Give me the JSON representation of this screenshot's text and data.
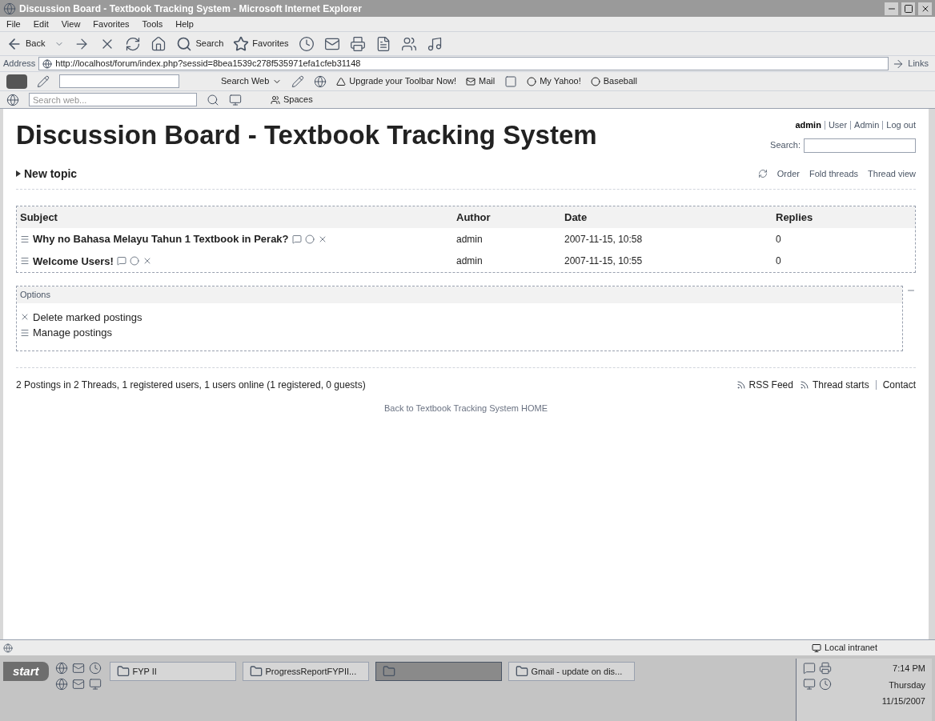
{
  "window": {
    "title": "Discussion Board - Textbook Tracking System - Microsoft Internet Explorer"
  },
  "menu": [
    "File",
    "Edit",
    "View",
    "Favorites",
    "Tools",
    "Help"
  ],
  "toolbar": {
    "back": "Back",
    "search": "Search",
    "favorites": "Favorites"
  },
  "address": {
    "label": "Address",
    "value": "http://localhost/forum/index.php?sessid=8bea1539c278f535971efa1cfeb31148",
    "links": "Links"
  },
  "yahoo_toolbar": {
    "search_web": "Search Web",
    "upgrade": "Upgrade your Toolbar Now!",
    "mail": "Mail",
    "my_yahoo": "My Yahoo!",
    "baseball": "Baseball"
  },
  "search_toolbar": {
    "placeholder": "Search web...",
    "spaces": "Spaces"
  },
  "page": {
    "title": "Discussion Board - Textbook Tracking System",
    "user_links": [
      {
        "label": "admin",
        "kind": "user"
      },
      {
        "label": "User",
        "kind": "link"
      },
      {
        "label": "Admin",
        "kind": "link"
      },
      {
        "label": "Log out",
        "kind": "link"
      }
    ],
    "search_label": "Search:",
    "new_topic": "New topic",
    "view_links": [
      "Order",
      "Fold threads",
      "Thread view"
    ],
    "table": {
      "columns": [
        "Subject",
        "Author",
        "Date",
        "Replies"
      ],
      "rows": [
        {
          "subject": "Why no Bahasa Melayu Tahun 1 Textbook in Perak?",
          "author": "admin",
          "date": "2007-11-15, 10:58",
          "replies": "0"
        },
        {
          "subject": "Welcome Users!",
          "author": "admin",
          "date": "2007-11-15, 10:55",
          "replies": "0"
        }
      ]
    },
    "options": {
      "title": "Options",
      "items": [
        "Delete marked postings",
        "Manage postings"
      ]
    },
    "stats": "2 Postings in 2 Threads, 1 registered users, 1 users online (1 registered, 0 guests)",
    "footer_links": [
      "RSS Feed",
      "Thread starts",
      "Contact"
    ],
    "back_link": "Back to Textbook Tracking System HOME"
  },
  "status_bar": {
    "zone": "Local intranet"
  },
  "taskbar": {
    "start": "start",
    "tasks": [
      {
        "label": "FYP II",
        "selected": false
      },
      {
        "label": "ProgressReportFYPII...",
        "selected": false
      },
      {
        "selected": true
      },
      {
        "label": "Gmail - update on dis...",
        "selected": false
      }
    ],
    "clock": {
      "time": "7:14 PM",
      "day": "Thursday",
      "date": "11/15/2007"
    }
  }
}
